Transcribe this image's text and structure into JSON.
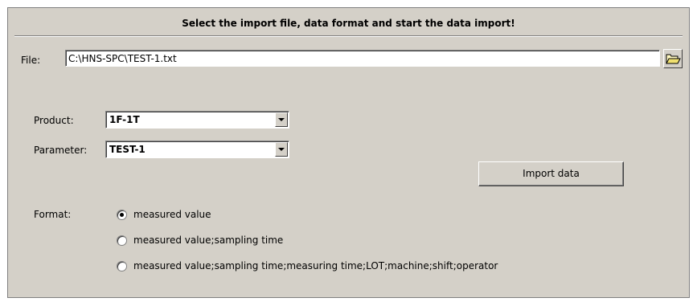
{
  "title": "Select the import file, data format and start the data import!",
  "file": {
    "label": "File:",
    "value": "C:\\HNS-SPC\\TEST-1.txt",
    "browse_icon": "folder-open-icon"
  },
  "product": {
    "label": "Product:",
    "selected": "1F-1T"
  },
  "parameter": {
    "label": "Parameter:",
    "selected": "TEST-1"
  },
  "import_button": "Import data",
  "format": {
    "label": "Format:",
    "options": [
      {
        "label": "measured value",
        "checked": true
      },
      {
        "label": "measured value;sampling time",
        "checked": false
      },
      {
        "label": "measured value;sampling time;measuring time;LOT;machine;shift;operator",
        "checked": false
      }
    ]
  }
}
